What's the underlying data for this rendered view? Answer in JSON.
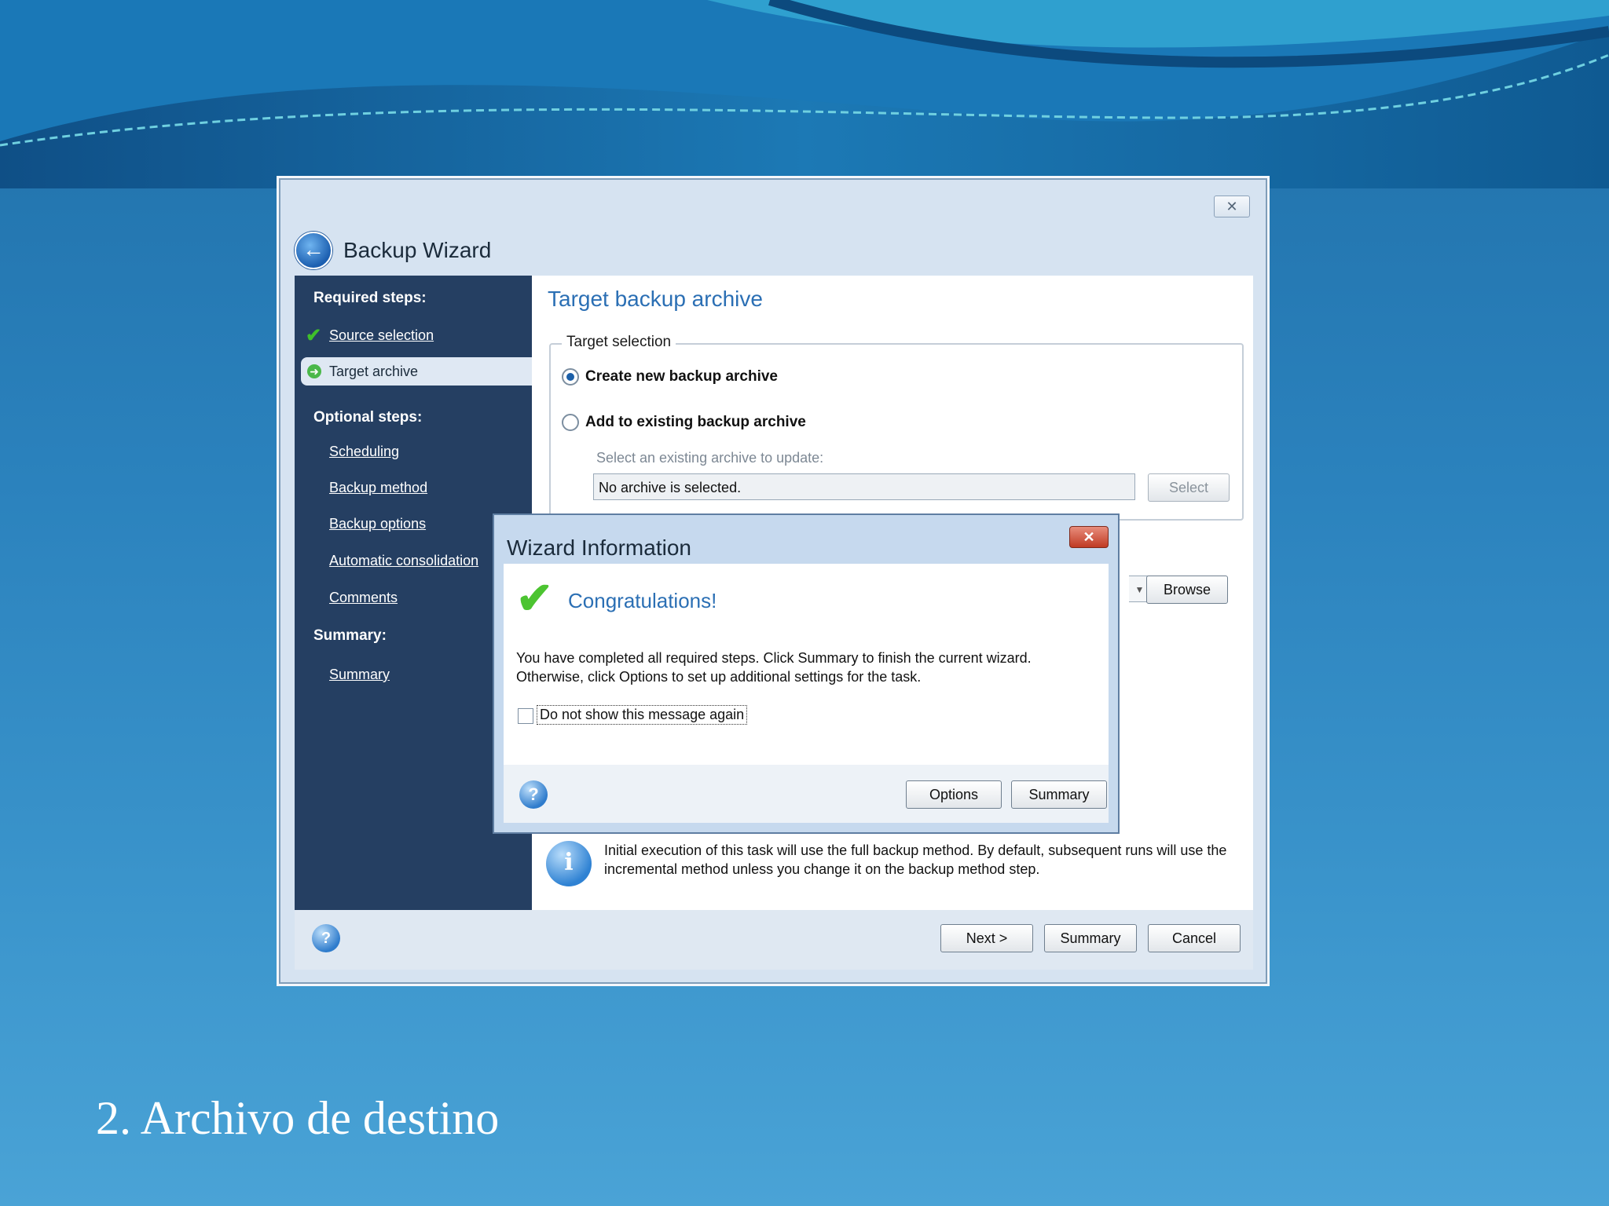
{
  "slide": {
    "caption": "2. Archivo de destino"
  },
  "window": {
    "title": "Backup Wizard",
    "close_label": "✕",
    "back_icon": "back-arrow-icon"
  },
  "sidebar": {
    "required_heading": "Required steps:",
    "required_items": [
      {
        "label": "Source selection",
        "state": "done"
      },
      {
        "label": "Target archive",
        "state": "current"
      }
    ],
    "optional_heading": "Optional steps:",
    "optional_items": [
      {
        "label": "Scheduling"
      },
      {
        "label": "Backup method"
      },
      {
        "label": "Backup options"
      },
      {
        "label": "Automatic consolidation"
      },
      {
        "label": "Comments"
      }
    ],
    "summary_heading": "Summary:",
    "summary_items": [
      {
        "label": "Summary"
      }
    ]
  },
  "content": {
    "title": "Target backup archive",
    "group_label": "Target selection",
    "option_new": "Create new backup archive",
    "option_existing": "Add to existing backup archive",
    "existing_prompt": "Select an existing archive to update:",
    "archive_value": "No archive is selected.",
    "select_button": "Select",
    "browse_button": "Browse",
    "info_text": "Initial execution of this task will use the full backup method. By default, subsequent runs will use the incremental method unless you change it on the backup method step."
  },
  "footer": {
    "next_button": "Next >",
    "summary_button": "Summary",
    "cancel_button": "Cancel"
  },
  "modal": {
    "title": "Wizard Information",
    "close_label": "✕",
    "heading": "Congratulations!",
    "message": "You have completed all required steps. Click Summary to finish the current wizard. Otherwise, click Options to set up additional settings for the task.",
    "checkbox_label": "Do not show this message again",
    "options_button": "Options",
    "summary_button": "Summary"
  },
  "colors": {
    "sidebar_bg": "#253f62",
    "accent_blue": "#2b6fb4",
    "check_green": "#4cc431"
  }
}
